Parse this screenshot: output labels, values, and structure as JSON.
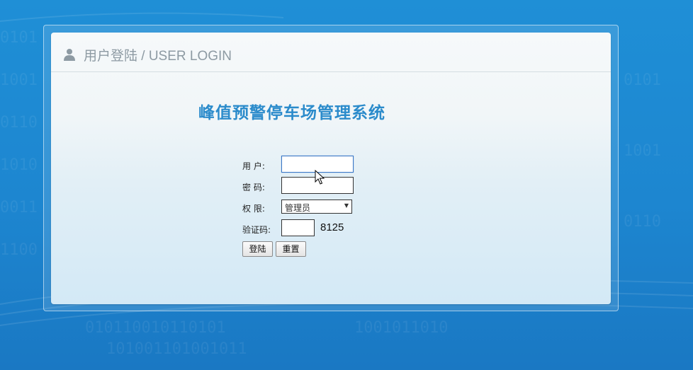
{
  "login_panel": {
    "header_title": "用户登陆 / USER LOGIN",
    "system_title": "峰值预警停车场管理系统"
  },
  "form": {
    "username_label": "用  户:",
    "username_value": "",
    "password_label": "密  码:",
    "password_value": "",
    "role_label": "权  限:",
    "role_selected": "管理员",
    "captcha_label": "验证码:",
    "captcha_value": "",
    "captcha_code": "8125"
  },
  "buttons": {
    "login_label": "登陆",
    "reset_label": "重置"
  },
  "icons": {
    "header_icon": "user-icon",
    "select_icon": "dropdown-arrow-icon",
    "cursor_icon": "mouse-pointer-icon"
  },
  "colors": {
    "background": "#1f8fd6",
    "title_blue": "#2b8bcb",
    "header_text": "#8d9aa3",
    "focus_border": "#3c78c5"
  }
}
